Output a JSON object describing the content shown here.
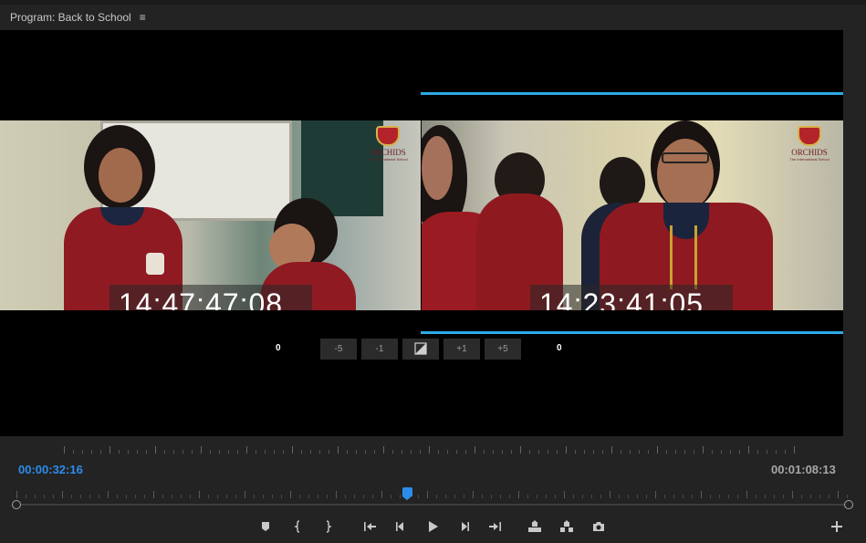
{
  "panel": {
    "title": "Program: Back to School",
    "menu_icon": "hamburger-icon",
    "menu_glyph": "≡"
  },
  "viewer": {
    "left_clip": {
      "timecode": "14:47:47:08",
      "logo_text": "ORCHIDS",
      "logo_sub": "The International School"
    },
    "right_clip": {
      "timecode": "14:23:41:05",
      "logo_text": "ORCHIDS",
      "logo_sub": "The International School"
    },
    "trim_line_color": "#2ea9e6"
  },
  "trim": {
    "left_offset": "0",
    "right_offset": "0",
    "buttons": [
      {
        "label": "-5",
        "name": "trim-back-five-button"
      },
      {
        "label": "-1",
        "name": "trim-back-one-button"
      },
      {
        "label": "",
        "name": "apply-default-transition-button",
        "icon": "transition-icon"
      },
      {
        "label": "+1",
        "name": "trim-forward-one-button"
      },
      {
        "label": "+5",
        "name": "trim-forward-five-button"
      }
    ]
  },
  "timecodes": {
    "current": "00:00:32:16",
    "duration": "00:01:08:13",
    "current_color": "#2d8ceb"
  },
  "playhead_position": 0.47,
  "transport": [
    {
      "name": "add-marker-button",
      "icon": "marker-icon"
    },
    {
      "name": "mark-in-button",
      "icon": "mark-in-icon"
    },
    {
      "name": "mark-out-button",
      "icon": "mark-out-icon"
    },
    {
      "name": "go-to-in-button",
      "icon": "go-to-in-icon"
    },
    {
      "name": "step-back-button",
      "icon": "step-back-icon"
    },
    {
      "name": "play-button",
      "icon": "play-icon"
    },
    {
      "name": "step-forward-button",
      "icon": "step-forward-icon"
    },
    {
      "name": "go-to-out-button",
      "icon": "go-to-out-icon"
    },
    {
      "name": "lift-button",
      "icon": "lift-icon"
    },
    {
      "name": "extract-button",
      "icon": "extract-icon"
    },
    {
      "name": "export-frame-button",
      "icon": "camera-icon"
    },
    {
      "name": "button-editor-button",
      "icon": "plus-icon"
    }
  ]
}
